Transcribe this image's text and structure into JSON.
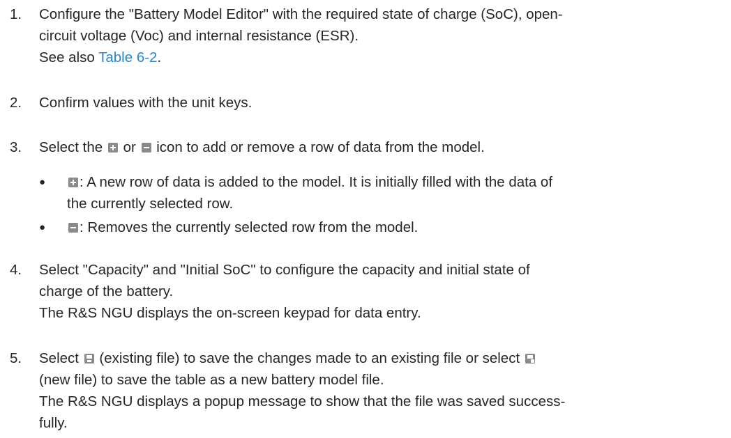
{
  "steps": [
    {
      "number": "1.",
      "line1": "Configure the \"Battery Model Editor\" with the required state of charge (SoC), open-",
      "line2": "circuit voltage (Voc) and internal resistance (ESR).",
      "see_prefix": "See also ",
      "see_link": "Table 6-2",
      "see_suffix": "."
    },
    {
      "number": "2.",
      "text": "Confirm values with the unit keys."
    },
    {
      "number": "3.",
      "part1": "Select the ",
      "part2": " or ",
      "part3": " icon to add or remove a row of data from the model.",
      "bullets": [
        {
          "dot": "●",
          "line1": ": A new row of data is added to the model. It is initially filled with the data of",
          "line2": "the currently selected row."
        },
        {
          "dot": "●",
          "line1": ": Removes the currently selected row from the model."
        }
      ]
    },
    {
      "number": "4.",
      "line1": "Select \"Capacity\" and \"Initial SoC\" to configure the capacity and initial state of",
      "line2": "charge of the battery.",
      "line3": "The R&S NGU displays the on-screen keypad for data entry."
    },
    {
      "number": "5.",
      "line1_a": "Select ",
      "line1_b": " (existing file) to save the changes made to an existing file or select ",
      "line2": "(new file) to save the table as a new battery model file.",
      "line3": "The R&S NGU displays a popup message to show that the file was saved success-",
      "line4": "fully."
    }
  ],
  "icons": {
    "add": "plus-icon",
    "remove": "minus-icon",
    "save_existing": "save-icon",
    "save_new": "save-as-icon",
    "icon_color": "#8a8a8a",
    "link_color": "#2a86c8"
  }
}
